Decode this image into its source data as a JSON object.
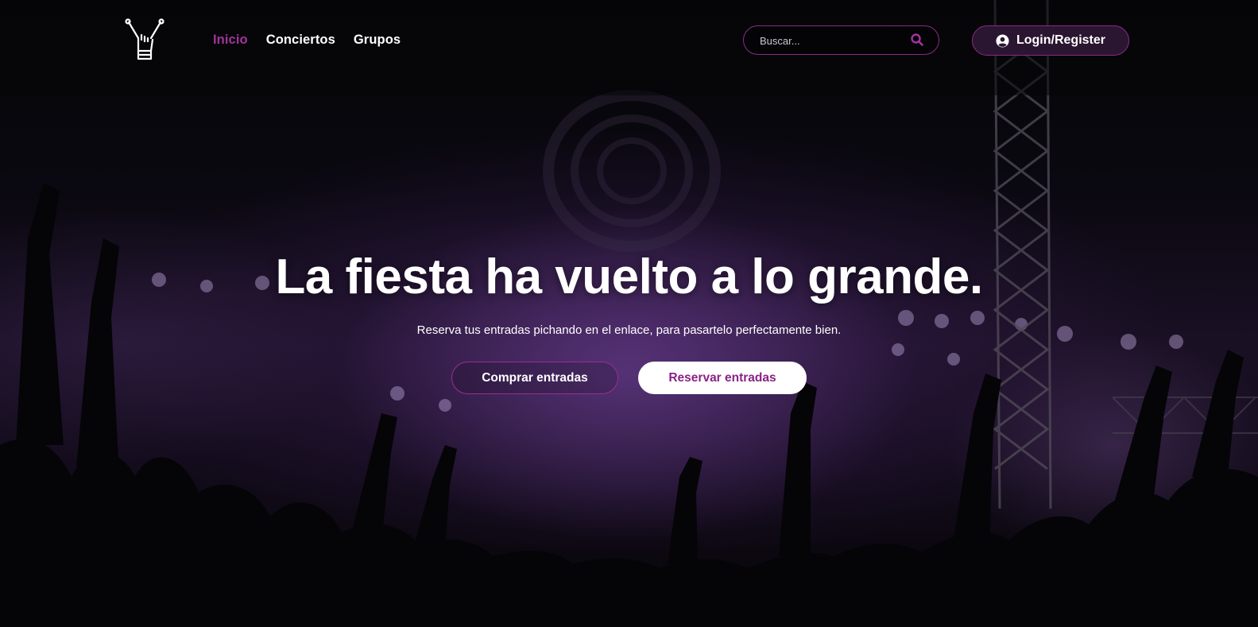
{
  "nav": {
    "logo_icon": "rock-hand-icon",
    "links": [
      {
        "label": "Inicio",
        "active": true
      },
      {
        "label": "Conciertos",
        "active": false
      },
      {
        "label": "Grupos",
        "active": false
      }
    ],
    "search": {
      "placeholder": "Buscar...",
      "value": "",
      "icon": "search-icon"
    },
    "login": {
      "label": "Login/Register",
      "icon": "user-circle-icon"
    }
  },
  "hero": {
    "title": "La fiesta ha vuelto a lo grande.",
    "subtitle": "Reserva tus entradas pichando en el enlace, para pasartelo perfectamente bien.",
    "buttons": {
      "buy": "Comprar entradas",
      "reserve": "Reservar entradas"
    }
  },
  "colors": {
    "accent": "#a1349c",
    "accent_border": "#8c2a88",
    "background": "#07060a",
    "button_solid_bg": "#ffffff",
    "button_solid_text": "#8a2285"
  }
}
